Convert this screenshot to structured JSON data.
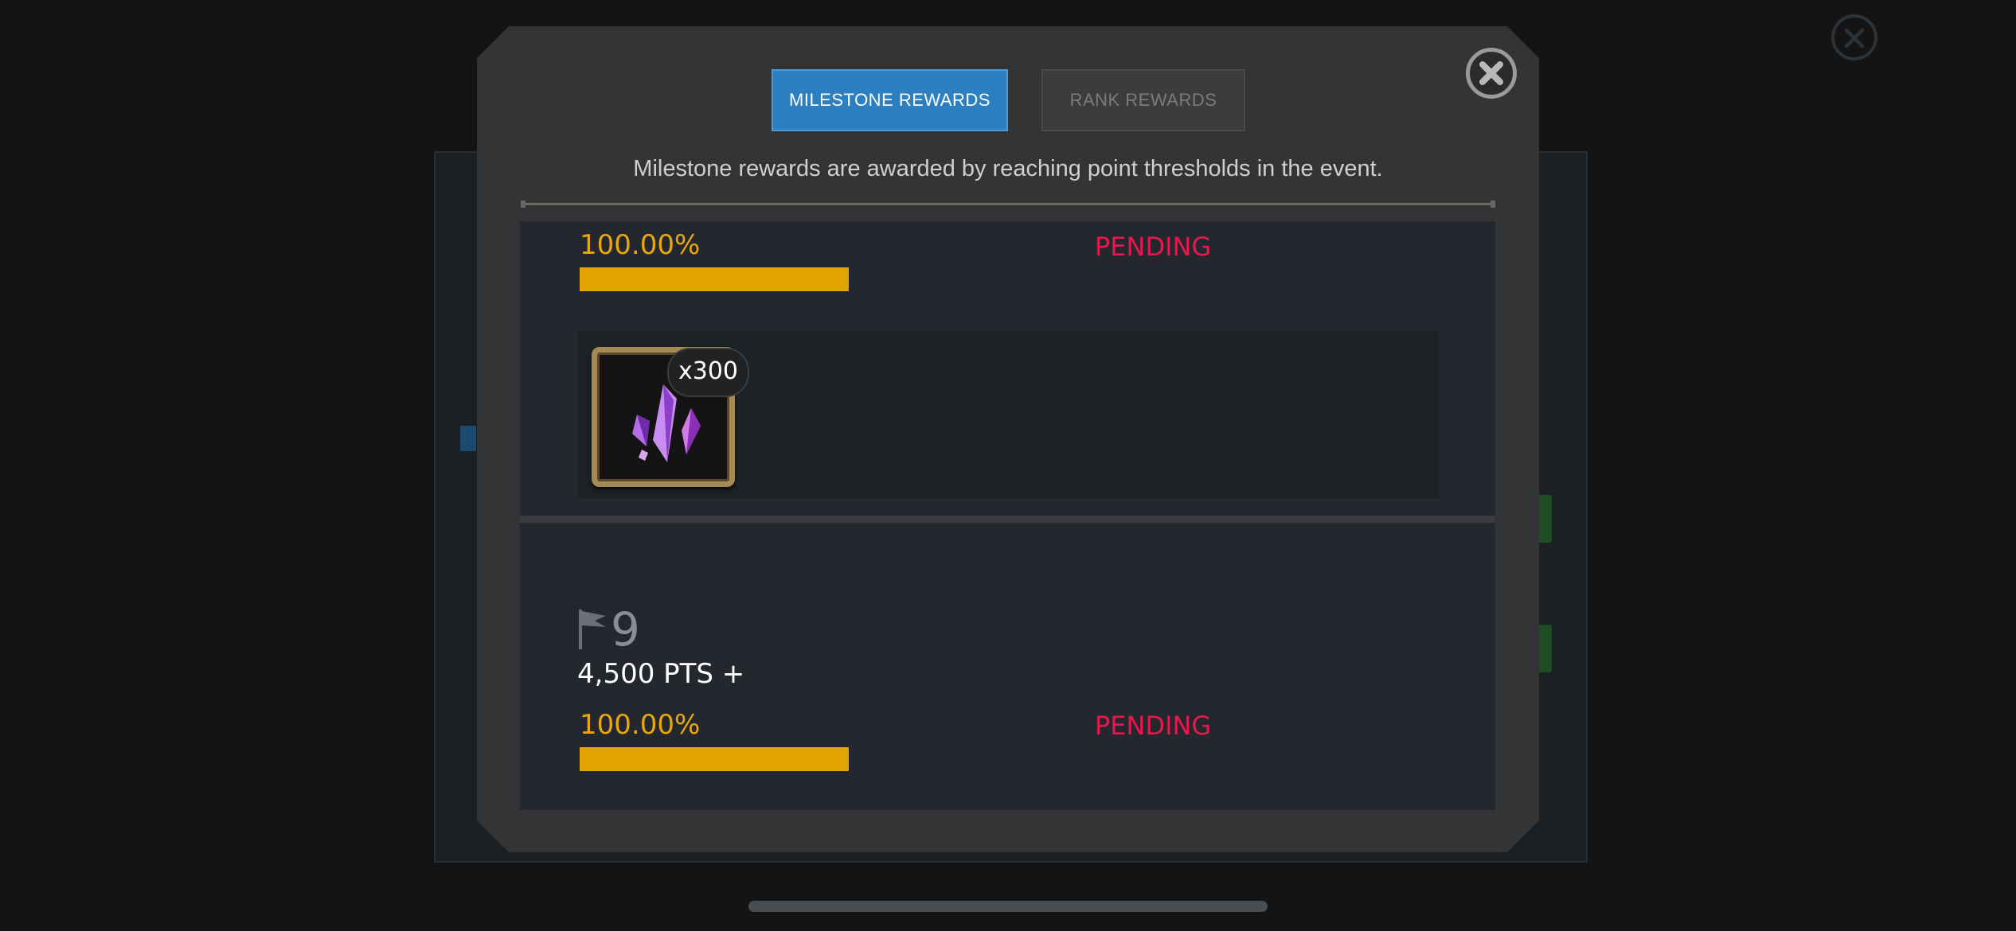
{
  "tabs": {
    "milestone_label": "MILESTONE REWARDS",
    "rank_label": "RANK REWARDS"
  },
  "description": "Milestone rewards are awarded by reaching point thresholds in the event.",
  "milestones": [
    {
      "progress_text": "100.00%",
      "progress": 1.0,
      "status": "PENDING",
      "reward_quantity": "x300",
      "reward_icon": "purple-crystal-shards-icon"
    },
    {
      "milestone_number": "9",
      "points": "4,500 PTS +",
      "progress_text": "100.00%",
      "progress": 1.0,
      "status": "PENDING"
    }
  ],
  "colors": {
    "tab_active": "#2c7fc1",
    "progress": "#e1a400",
    "pending": "#e8174e",
    "percent": "#e8a80c"
  }
}
